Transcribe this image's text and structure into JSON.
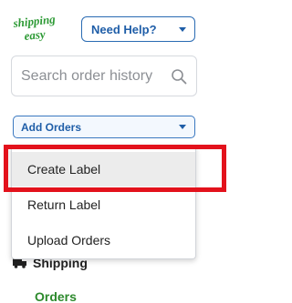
{
  "brand": {
    "logo_line1": "shipping",
    "logo_line2": "easy",
    "logo_color": "#2d9a35"
  },
  "header": {
    "help_label": "Need Help?"
  },
  "search": {
    "placeholder": "Search order history",
    "value": ""
  },
  "add_orders": {
    "label": "Add Orders",
    "menu": {
      "items": [
        {
          "label": "Create Label",
          "highlighted": true
        },
        {
          "label": "Return Label"
        },
        {
          "label": "Upload Orders"
        }
      ]
    }
  },
  "nav": {
    "shipping_label": "Shipping",
    "orders_label": "Orders"
  },
  "colors": {
    "accent": "#1f5ea8",
    "highlight_border": "#e3121c",
    "nav_active": "#2d8a2d"
  }
}
